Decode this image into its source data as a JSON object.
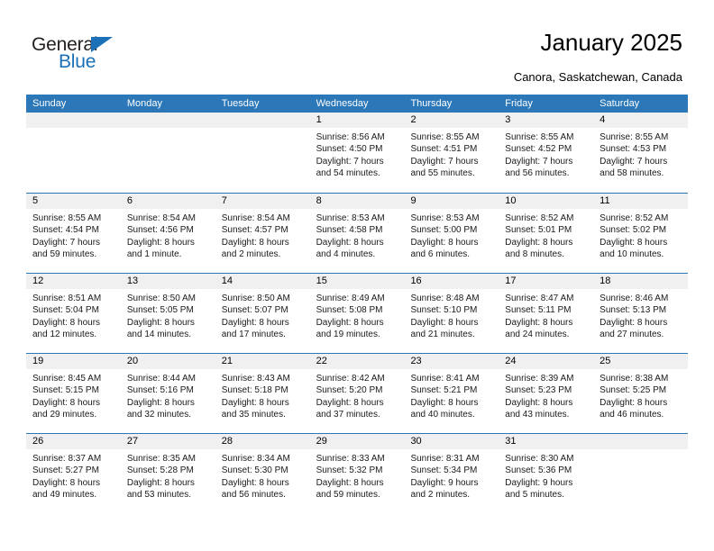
{
  "brand": {
    "name_part1": "General",
    "name_part2": "Blue",
    "color_dark": "#231f20",
    "color_blue": "#1b70b8"
  },
  "header": {
    "title": "January 2025",
    "subtitle": "Canora, Saskatchewan, Canada"
  },
  "theme": {
    "header_blue": "#2b77b8",
    "daynum_band": "#f0f0f0",
    "cell_bg": "#ffffff"
  },
  "calendar": {
    "weekday_headers": [
      "Sunday",
      "Monday",
      "Tuesday",
      "Wednesday",
      "Thursday",
      "Friday",
      "Saturday"
    ],
    "weeks": [
      [
        {
          "empty": true
        },
        {
          "empty": true
        },
        {
          "empty": true
        },
        {
          "day": "1",
          "sunrise": "Sunrise: 8:56 AM",
          "sunset": "Sunset: 4:50 PM",
          "daylight1": "Daylight: 7 hours",
          "daylight2": "and 54 minutes."
        },
        {
          "day": "2",
          "sunrise": "Sunrise: 8:55 AM",
          "sunset": "Sunset: 4:51 PM",
          "daylight1": "Daylight: 7 hours",
          "daylight2": "and 55 minutes."
        },
        {
          "day": "3",
          "sunrise": "Sunrise: 8:55 AM",
          "sunset": "Sunset: 4:52 PM",
          "daylight1": "Daylight: 7 hours",
          "daylight2": "and 56 minutes."
        },
        {
          "day": "4",
          "sunrise": "Sunrise: 8:55 AM",
          "sunset": "Sunset: 4:53 PM",
          "daylight1": "Daylight: 7 hours",
          "daylight2": "and 58 minutes."
        }
      ],
      [
        {
          "day": "5",
          "sunrise": "Sunrise: 8:55 AM",
          "sunset": "Sunset: 4:54 PM",
          "daylight1": "Daylight: 7 hours",
          "daylight2": "and 59 minutes."
        },
        {
          "day": "6",
          "sunrise": "Sunrise: 8:54 AM",
          "sunset": "Sunset: 4:56 PM",
          "daylight1": "Daylight: 8 hours",
          "daylight2": "and 1 minute."
        },
        {
          "day": "7",
          "sunrise": "Sunrise: 8:54 AM",
          "sunset": "Sunset: 4:57 PM",
          "daylight1": "Daylight: 8 hours",
          "daylight2": "and 2 minutes."
        },
        {
          "day": "8",
          "sunrise": "Sunrise: 8:53 AM",
          "sunset": "Sunset: 4:58 PM",
          "daylight1": "Daylight: 8 hours",
          "daylight2": "and 4 minutes."
        },
        {
          "day": "9",
          "sunrise": "Sunrise: 8:53 AM",
          "sunset": "Sunset: 5:00 PM",
          "daylight1": "Daylight: 8 hours",
          "daylight2": "and 6 minutes."
        },
        {
          "day": "10",
          "sunrise": "Sunrise: 8:52 AM",
          "sunset": "Sunset: 5:01 PM",
          "daylight1": "Daylight: 8 hours",
          "daylight2": "and 8 minutes."
        },
        {
          "day": "11",
          "sunrise": "Sunrise: 8:52 AM",
          "sunset": "Sunset: 5:02 PM",
          "daylight1": "Daylight: 8 hours",
          "daylight2": "and 10 minutes."
        }
      ],
      [
        {
          "day": "12",
          "sunrise": "Sunrise: 8:51 AM",
          "sunset": "Sunset: 5:04 PM",
          "daylight1": "Daylight: 8 hours",
          "daylight2": "and 12 minutes."
        },
        {
          "day": "13",
          "sunrise": "Sunrise: 8:50 AM",
          "sunset": "Sunset: 5:05 PM",
          "daylight1": "Daylight: 8 hours",
          "daylight2": "and 14 minutes."
        },
        {
          "day": "14",
          "sunrise": "Sunrise: 8:50 AM",
          "sunset": "Sunset: 5:07 PM",
          "daylight1": "Daylight: 8 hours",
          "daylight2": "and 17 minutes."
        },
        {
          "day": "15",
          "sunrise": "Sunrise: 8:49 AM",
          "sunset": "Sunset: 5:08 PM",
          "daylight1": "Daylight: 8 hours",
          "daylight2": "and 19 minutes."
        },
        {
          "day": "16",
          "sunrise": "Sunrise: 8:48 AM",
          "sunset": "Sunset: 5:10 PM",
          "daylight1": "Daylight: 8 hours",
          "daylight2": "and 21 minutes."
        },
        {
          "day": "17",
          "sunrise": "Sunrise: 8:47 AM",
          "sunset": "Sunset: 5:11 PM",
          "daylight1": "Daylight: 8 hours",
          "daylight2": "and 24 minutes."
        },
        {
          "day": "18",
          "sunrise": "Sunrise: 8:46 AM",
          "sunset": "Sunset: 5:13 PM",
          "daylight1": "Daylight: 8 hours",
          "daylight2": "and 27 minutes."
        }
      ],
      [
        {
          "day": "19",
          "sunrise": "Sunrise: 8:45 AM",
          "sunset": "Sunset: 5:15 PM",
          "daylight1": "Daylight: 8 hours",
          "daylight2": "and 29 minutes."
        },
        {
          "day": "20",
          "sunrise": "Sunrise: 8:44 AM",
          "sunset": "Sunset: 5:16 PM",
          "daylight1": "Daylight: 8 hours",
          "daylight2": "and 32 minutes."
        },
        {
          "day": "21",
          "sunrise": "Sunrise: 8:43 AM",
          "sunset": "Sunset: 5:18 PM",
          "daylight1": "Daylight: 8 hours",
          "daylight2": "and 35 minutes."
        },
        {
          "day": "22",
          "sunrise": "Sunrise: 8:42 AM",
          "sunset": "Sunset: 5:20 PM",
          "daylight1": "Daylight: 8 hours",
          "daylight2": "and 37 minutes."
        },
        {
          "day": "23",
          "sunrise": "Sunrise: 8:41 AM",
          "sunset": "Sunset: 5:21 PM",
          "daylight1": "Daylight: 8 hours",
          "daylight2": "and 40 minutes."
        },
        {
          "day": "24",
          "sunrise": "Sunrise: 8:39 AM",
          "sunset": "Sunset: 5:23 PM",
          "daylight1": "Daylight: 8 hours",
          "daylight2": "and 43 minutes."
        },
        {
          "day": "25",
          "sunrise": "Sunrise: 8:38 AM",
          "sunset": "Sunset: 5:25 PM",
          "daylight1": "Daylight: 8 hours",
          "daylight2": "and 46 minutes."
        }
      ],
      [
        {
          "day": "26",
          "sunrise": "Sunrise: 8:37 AM",
          "sunset": "Sunset: 5:27 PM",
          "daylight1": "Daylight: 8 hours",
          "daylight2": "and 49 minutes."
        },
        {
          "day": "27",
          "sunrise": "Sunrise: 8:35 AM",
          "sunset": "Sunset: 5:28 PM",
          "daylight1": "Daylight: 8 hours",
          "daylight2": "and 53 minutes."
        },
        {
          "day": "28",
          "sunrise": "Sunrise: 8:34 AM",
          "sunset": "Sunset: 5:30 PM",
          "daylight1": "Daylight: 8 hours",
          "daylight2": "and 56 minutes."
        },
        {
          "day": "29",
          "sunrise": "Sunrise: 8:33 AM",
          "sunset": "Sunset: 5:32 PM",
          "daylight1": "Daylight: 8 hours",
          "daylight2": "and 59 minutes."
        },
        {
          "day": "30",
          "sunrise": "Sunrise: 8:31 AM",
          "sunset": "Sunset: 5:34 PM",
          "daylight1": "Daylight: 9 hours",
          "daylight2": "and 2 minutes."
        },
        {
          "day": "31",
          "sunrise": "Sunrise: 8:30 AM",
          "sunset": "Sunset: 5:36 PM",
          "daylight1": "Daylight: 9 hours",
          "daylight2": "and 5 minutes."
        },
        {
          "empty": true
        }
      ]
    ]
  }
}
